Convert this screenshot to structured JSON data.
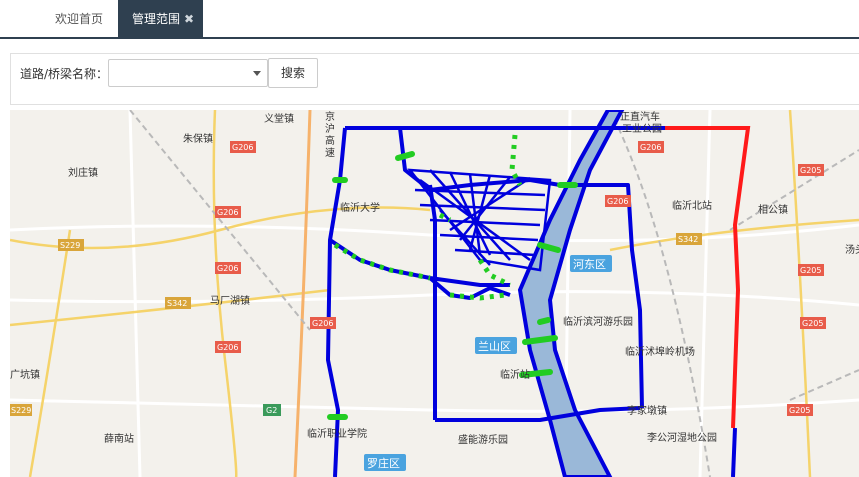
{
  "tabs": [
    {
      "label": "欢迎首页"
    },
    {
      "label": "管理范围",
      "close": "✖"
    }
  ],
  "search": {
    "label": "道路/桥梁名称：",
    "select_value": "",
    "button": "搜索"
  },
  "map": {
    "places": {
      "yiyang": "义堂镇",
      "zhubao": "朱保镇",
      "liuzhuang": "刘庄镇",
      "malan": "马厂湖镇",
      "kengzhen": "广坑镇",
      "xuenan": "薛南站",
      "jinghu_1": "京",
      "jinghu_2": "沪",
      "jinghu_3": "高",
      "jinghu_4": "速",
      "linyi_univ": "临沂大学",
      "linyi_north": "临沂北站",
      "xiangbo": "相公镇",
      "tangtou": "汤头",
      "zhengzhi": "正直汽车",
      "zhengzhi2": "工业公园",
      "binhe": "临沂滨河游乐园",
      "airport": "临沂沭埠岭机场",
      "linyi_station": "临沂站",
      "li_jiadun": "李家墩镇",
      "ligong": "李公河湿地公园",
      "vocational": "临沂职业学院",
      "shengneng": "盛能游乐园"
    },
    "districts": {
      "hedong": "河东区",
      "lanshan": "兰山区",
      "luozhuang": "罗庄区"
    },
    "roads": {
      "g206a": "G206",
      "g206b": "G206",
      "g206c": "G206",
      "g206d": "G206",
      "g206e": "G206",
      "g206f": "G206",
      "g206g": "G206",
      "g205a": "G205",
      "g205b": "G205",
      "g205c": "G205",
      "g205d": "G205",
      "s229a": "S229",
      "s229b": "S229",
      "s342a": "S342",
      "s342b": "S342",
      "g2": "G2"
    },
    "colors": {
      "boundary": "#0000dd",
      "highlight": "#ff1a1a",
      "bridge": "#22cc22",
      "river": "#9ab8d8"
    }
  }
}
